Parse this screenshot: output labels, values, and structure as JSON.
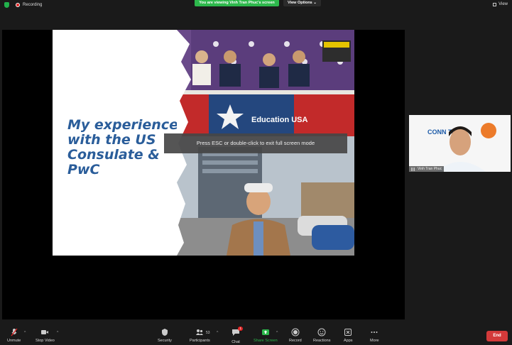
{
  "topbar": {
    "recording_label": "Recording",
    "viewing_banner": "You are viewing Vinh Tran Phuc's screen",
    "view_options_label": "View Options",
    "view_label": "View"
  },
  "shared_screen": {
    "slide_title": "My experience with the US Consulate & PwC",
    "banner_text": "Education USA",
    "fullscreen_hint": "Press ESC or double-click to exit full screen mode"
  },
  "video_tile": {
    "participant_name": "Vinh Tran Phuc",
    "background_text": "CONN Talk"
  },
  "toolbar": {
    "unmute": "Unmute",
    "stop_video": "Stop Video",
    "security": "Security",
    "participants": "Participants",
    "participants_count": "53",
    "chat": "Chat",
    "chat_badge": "1",
    "share_screen": "Share Screen",
    "record": "Record",
    "reactions": "Reactions",
    "apps": "Apps",
    "more": "More",
    "end": "End"
  },
  "colors": {
    "accent_green": "#2db84c",
    "end_red": "#d33a3a",
    "slide_title_blue": "#2a5d9a"
  }
}
